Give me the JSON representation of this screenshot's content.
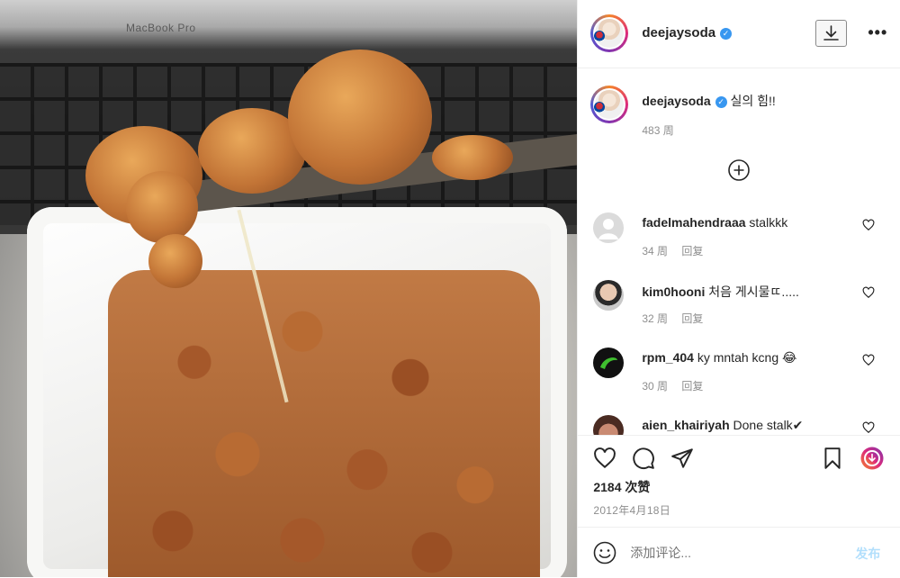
{
  "post": {
    "author": "deejaysoda",
    "caption": "실의 힘!!",
    "caption_time": "483 周",
    "likes": "2184 次赞",
    "date": "2012年4月18日"
  },
  "photo": {
    "laptop_brand": "MacBook Pro"
  },
  "comments": [
    {
      "user": "fadelmahendraaa",
      "text": "stalkkk",
      "time": "34 周",
      "reply": "回复"
    },
    {
      "user": "kim0hooni",
      "text": "처음 게시물ㄸ.....",
      "time": "32 周",
      "reply": "回复"
    },
    {
      "user": "rpm_404",
      "text": "ky mntah kcng 😂",
      "time": "30 周",
      "reply": "回复"
    },
    {
      "user": "aien_khairiyah",
      "text": "Done stalk✔",
      "time": "",
      "reply": ""
    }
  ],
  "add_comment": {
    "placeholder": "添加评论...",
    "post_label": "发布"
  },
  "colors": {
    "accent": "#3897f0",
    "muted": "#8e8e8e",
    "post_disabled": "#b2dffc"
  },
  "icons": {
    "verified": "verified-badge-icon",
    "download": "download-icon",
    "more": "more-icon",
    "load_more": "plus-circle-icon",
    "like": "heart-icon",
    "comment": "comment-bubble-icon",
    "share": "paper-plane-icon",
    "save": "bookmark-icon",
    "emoji": "emoji-icon"
  }
}
